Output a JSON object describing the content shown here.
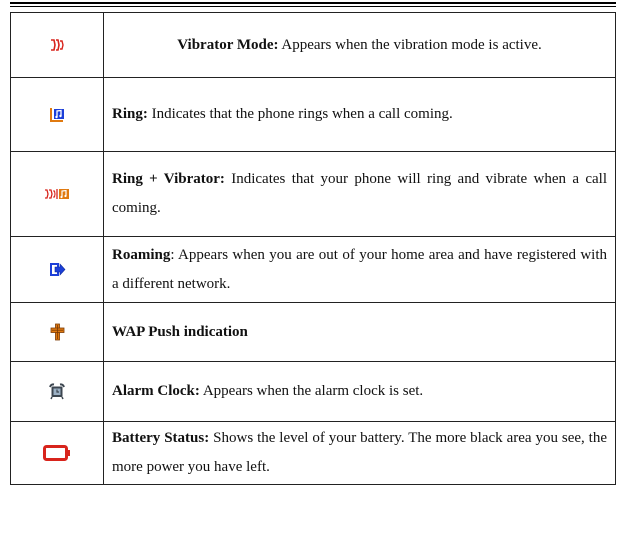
{
  "rows": [
    {
      "icon": "vibrator-icon",
      "title": "Vibrator Mode:",
      "text": " Appears when the vibration mode is active."
    },
    {
      "icon": "ring-icon",
      "title": "Ring:",
      "text": " Indicates that the phone rings when a call coming."
    },
    {
      "icon": "ring-vibrator-icon",
      "title": "Ring + Vibrator:",
      "text": " Indicates that your phone will ring and vibrate when a call coming."
    },
    {
      "icon": "roaming-icon",
      "title": "Roaming",
      "text": ": Appears when you are out of your home area and have registered with a different network."
    },
    {
      "icon": "wap-push-icon",
      "title": "WAP Push indication",
      "text": ""
    },
    {
      "icon": "alarm-clock-icon",
      "title": "Alarm Clock:",
      "text": " Appears when the alarm clock is set."
    },
    {
      "icon": "battery-icon",
      "title": "Battery Status:",
      "text": " Shows the level of your battery. The more black area you see, the more power you have left."
    }
  ],
  "colors": {
    "red": "#d8241c",
    "blue": "#1c3fd8",
    "orange": "#e07a10",
    "gray": "#3c4650"
  }
}
